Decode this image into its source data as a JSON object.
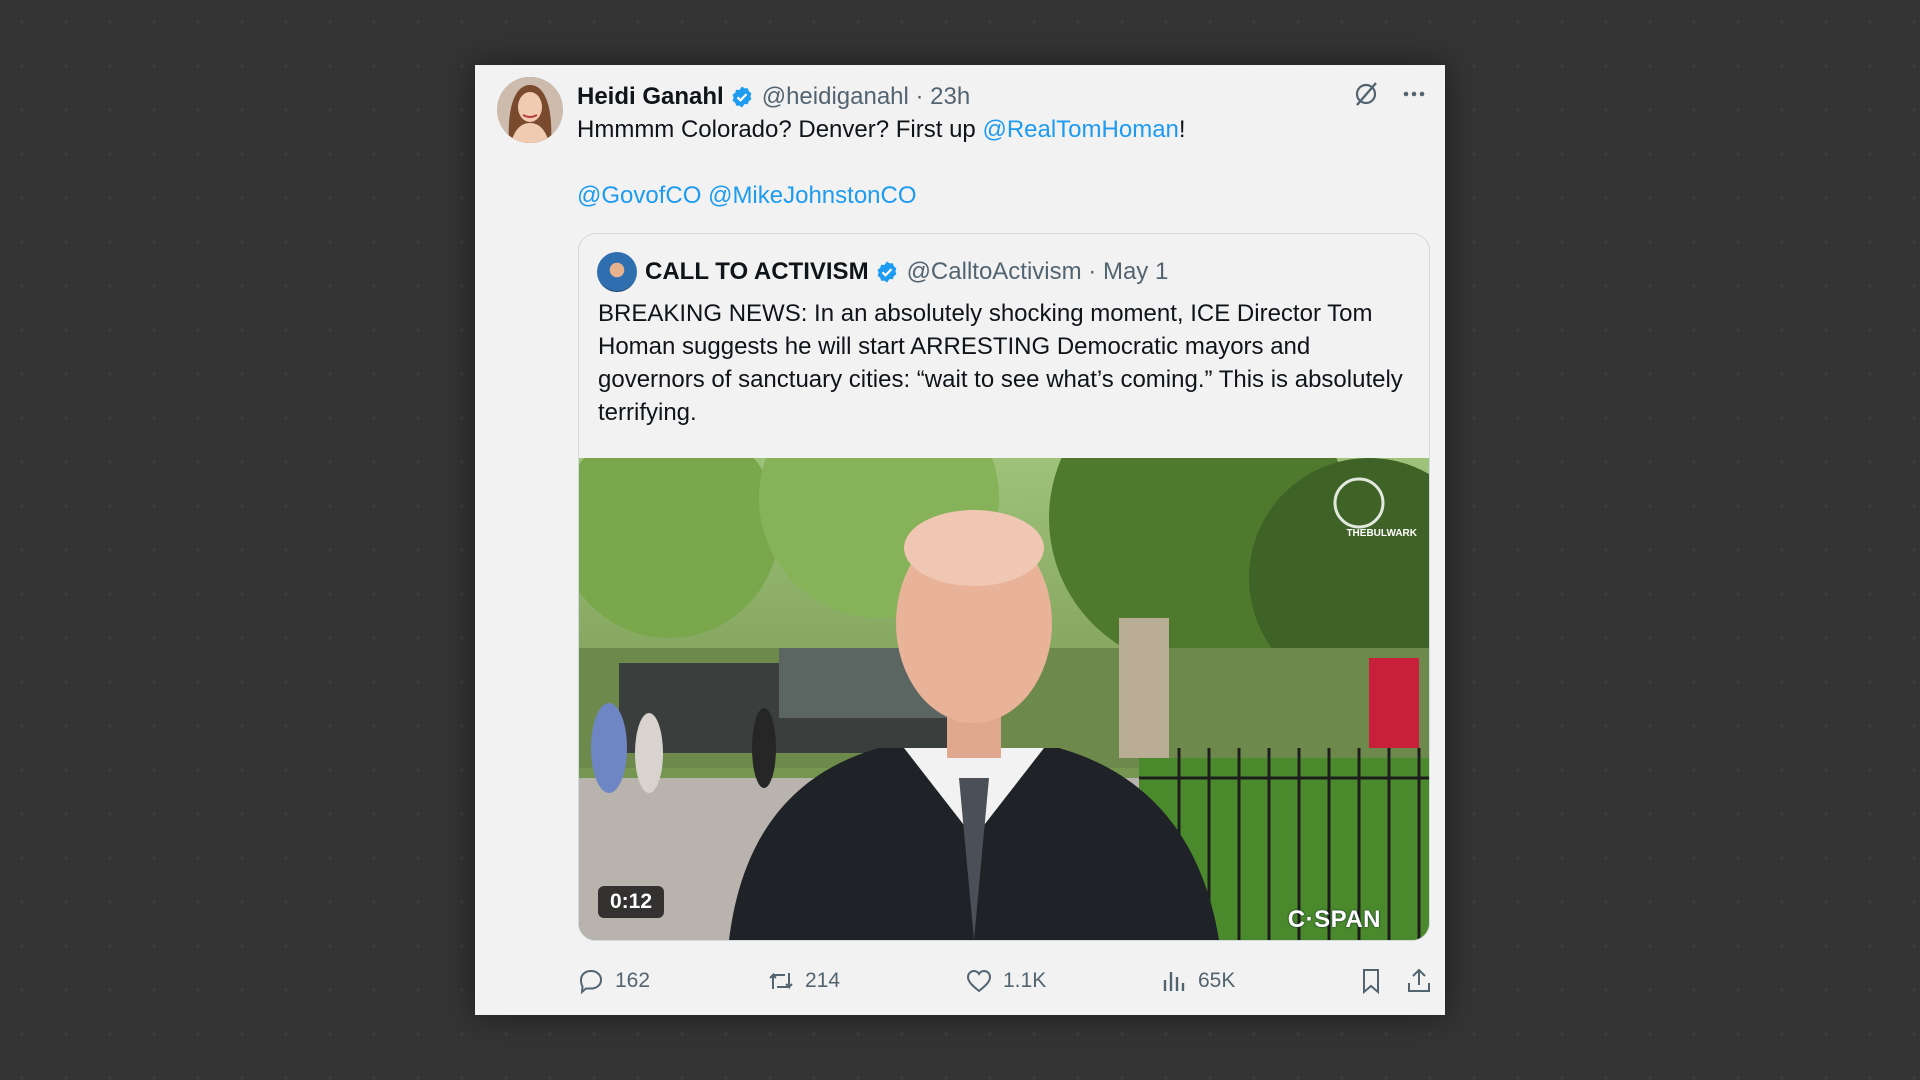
{
  "tweet": {
    "author_name": "Heidi Ganahl",
    "handle": "@heidiganahl",
    "time": "23h",
    "text_before": "Hmmmm Colorado? Denver? First up ",
    "text_link": "@RealTomHoman",
    "text_after": "!",
    "mentions": [
      "@GovofCO",
      "@MikeJohnstonCO"
    ]
  },
  "quote": {
    "author_name": "CALL TO ACTIVISM",
    "handle": "@CalltoActivism",
    "date": "May 1",
    "text": "BREAKING NEWS: In an absolutely shocking moment, ICE Director Tom Homan suggests he will start ARRESTING Democratic mayors and governors of sanctuary cities: “wait to see what’s coming.” This is absolutely terrifying.",
    "video": {
      "duration": "0:12",
      "watermark": "C·SPAN",
      "logo_text": "THEBULWARK"
    }
  },
  "actions": {
    "replies": "162",
    "reposts": "214",
    "likes": "1.1K",
    "views": "65K"
  },
  "icons": {
    "verified": "verified-badge-icon",
    "grok": "grok-icon",
    "more": "more-icon",
    "reply": "reply-icon",
    "repost": "repost-icon",
    "like": "like-icon",
    "views": "views-icon",
    "bookmark": "bookmark-icon",
    "share": "share-icon"
  },
  "colors": {
    "link": "#1d9bf0",
    "verified": "#1d9bf0",
    "muted": "#536471",
    "card_bg": "#f2f2f2",
    "page_bg": "#343434"
  }
}
